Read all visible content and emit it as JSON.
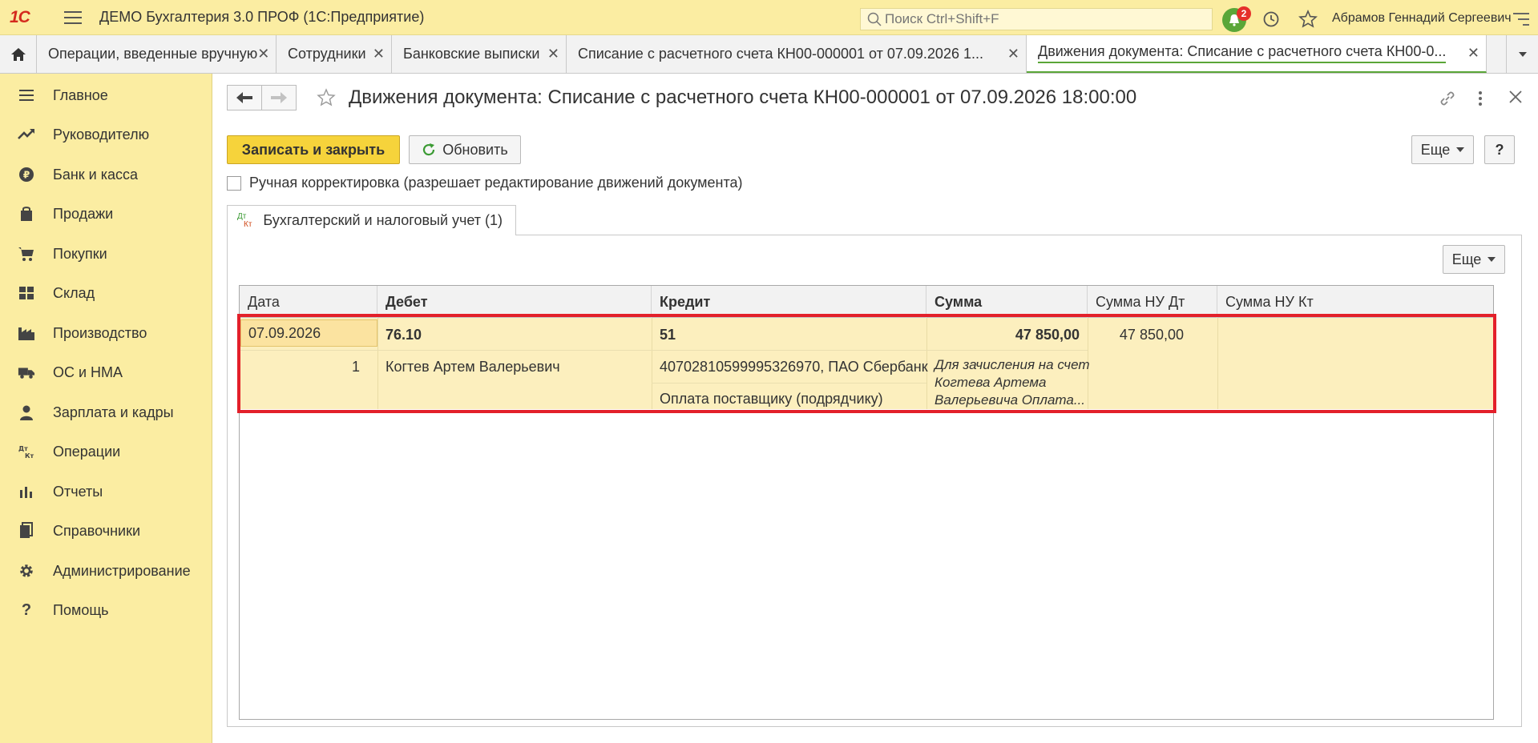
{
  "app": {
    "logo_text": "1С",
    "title": "ДЕМО Бухгалтерия 3.0 ПРОФ  (1С:Предприятие)",
    "search_placeholder": "Поиск Ctrl+Shift+F",
    "notification_count": "2",
    "user_name": "Абрамов Геннадий Сергеевич"
  },
  "tabs": [
    {
      "label": "Операции, введенные вручную"
    },
    {
      "label": "Сотрудники"
    },
    {
      "label": "Банковские выписки"
    },
    {
      "label": "Списание с расчетного счета КН00-000001 от 07.09.2026 1..."
    },
    {
      "label": "Движения документа: Списание с расчетного счета КН00-0...",
      "active": true
    }
  ],
  "sidebar": {
    "items": [
      {
        "label": "Главное",
        "icon": "menu-lines-icon"
      },
      {
        "label": "Руководителю",
        "icon": "trend-icon"
      },
      {
        "label": "Банк и касса",
        "icon": "ruble-coin-icon"
      },
      {
        "label": "Продажи",
        "icon": "shopping-bag-icon"
      },
      {
        "label": "Покупки",
        "icon": "cart-icon"
      },
      {
        "label": "Склад",
        "icon": "warehouse-icon"
      },
      {
        "label": "Производство",
        "icon": "factory-icon"
      },
      {
        "label": "ОС и НМА",
        "icon": "truck-icon"
      },
      {
        "label": "Зарплата и кадры",
        "icon": "person-icon"
      },
      {
        "label": "Операции",
        "icon": "dt-kt-icon"
      },
      {
        "label": "Отчеты",
        "icon": "bar-chart-icon"
      },
      {
        "label": "Справочники",
        "icon": "books-icon"
      },
      {
        "label": "Администрирование",
        "icon": "gear-icon"
      },
      {
        "label": "Помощь",
        "icon": "question-icon"
      }
    ]
  },
  "document": {
    "title": "Движения документа: Списание с расчетного счета КН00-000001 от 07.09.2026 18:00:00",
    "save_close_label": "Записать и закрыть",
    "refresh_label": "Обновить",
    "more_label": "Еще",
    "help_label": "?",
    "manual_correction_label": "Ручная корректировка (разрешает редактирование движений документа)",
    "manual_correction_checked": false,
    "subtab_icon_top": "Дт",
    "subtab_icon_bottom": "Кт",
    "subtab_label": "Бухгалтерский и налоговый учет (1)",
    "panel_more_label": "Еще"
  },
  "table": {
    "columns": [
      "Дата",
      "Дебет",
      "Кредит",
      "Сумма",
      "Сумма НУ Дт",
      "Сумма НУ Кт"
    ],
    "rows": [
      {
        "date": "07.09.2026",
        "line_no": "1",
        "debit_account": "76.10",
        "debit_subconto1": "Когтев Артем Валерьевич",
        "credit_account": "51",
        "credit_subconto1": "40702810599995326970, ПАО Сбербанк",
        "credit_subconto2": "Оплата поставщику (подрядчику)",
        "amount": "47 850,00",
        "content_line1": "Для зачисления на счет",
        "content_line2": "Когтева Артема",
        "content_line3": "Валерьевича Оплата...",
        "amount_nu_dt": "47 850,00",
        "amount_nu_kt": ""
      }
    ]
  },
  "colors": {
    "accent_yellow": "#f6d33b",
    "sidebar_bg": "#fbeda2",
    "active_tab_underline": "#5aa638",
    "selection_frame": "#e3202a",
    "row_highlight": "#fcefbe"
  }
}
